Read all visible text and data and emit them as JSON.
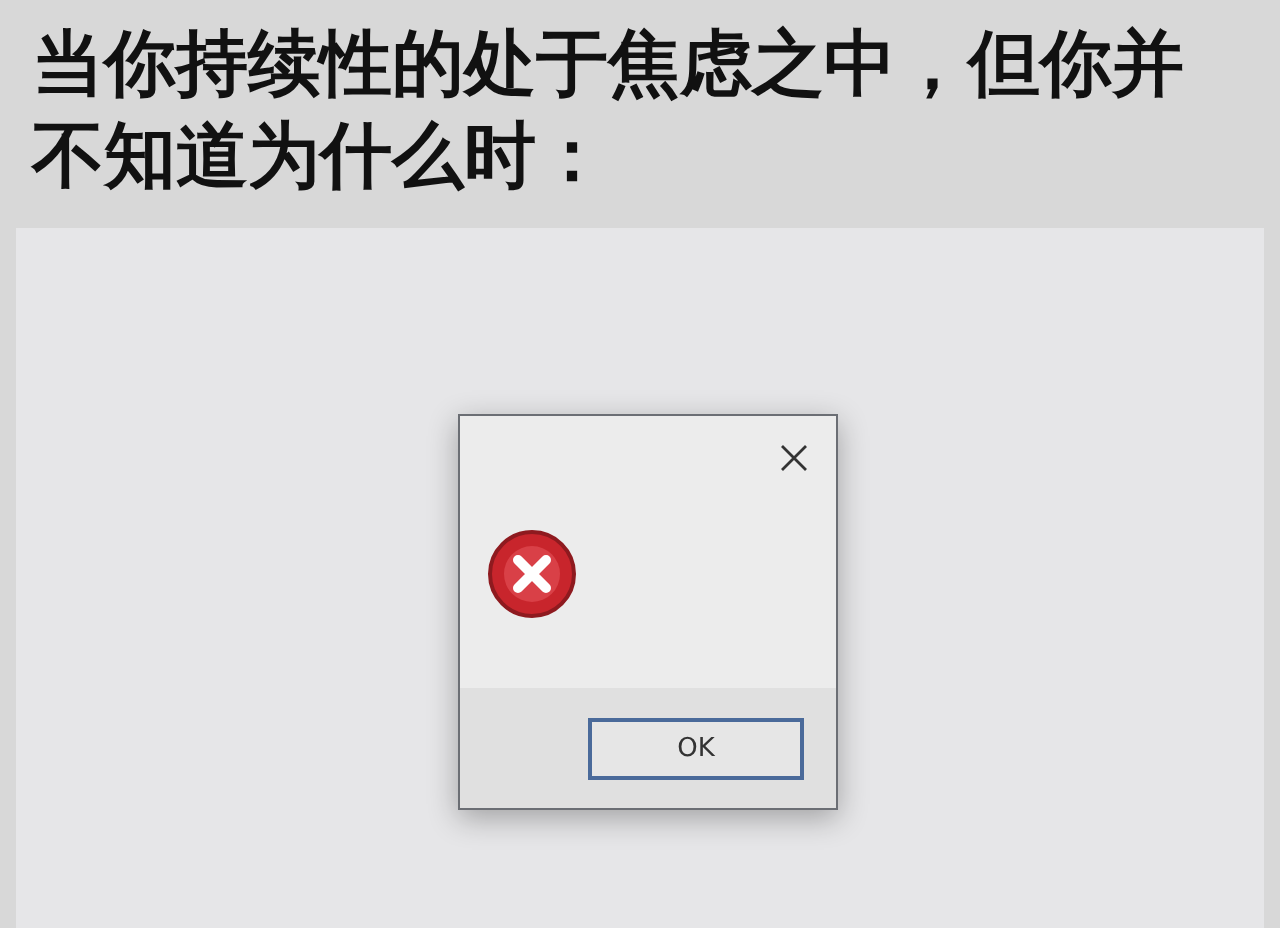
{
  "caption": "当你持续性的处于焦虑之中，但你并不知道为什么时：",
  "dialog": {
    "buttons": [
      {
        "label": "OK",
        "focused": true
      }
    ]
  }
}
